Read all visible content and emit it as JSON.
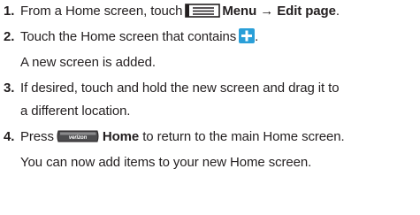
{
  "steps": [
    {
      "number": "1.",
      "pre": "From a Home screen, touch",
      "icon": "menu-key-icon",
      "bold1": "Menu",
      "arrow": "→",
      "bold2": "Edit page",
      "post": "."
    },
    {
      "number": "2.",
      "pre": "Touch the Home screen that contains",
      "icon": "plus-icon",
      "post": ".",
      "note": "A new screen is added."
    },
    {
      "number": "3.",
      "line1": "If desired, touch and hold the new screen and drag it to",
      "line2": "a different location."
    },
    {
      "number": "4.",
      "pre": "Press",
      "icon": "home-key-icon",
      "icon_text": "verizon",
      "bold1": "Home",
      "post": "to return to the main Home screen.",
      "note": "You can now add items to your new Home screen."
    }
  ],
  "colors": {
    "text": "#231f20",
    "plus_icon_bg": "#2a9fd8",
    "menu_icon_stroke": "#231f20"
  }
}
